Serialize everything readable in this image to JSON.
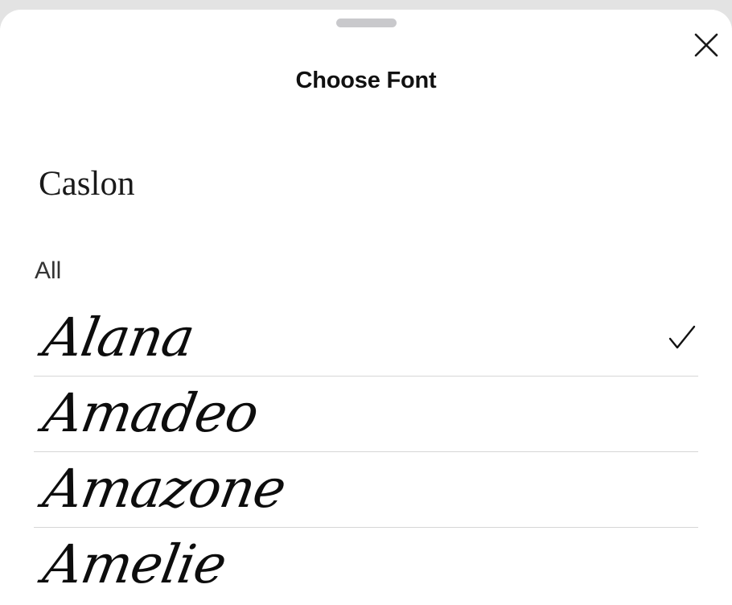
{
  "sheet": {
    "title": "Choose Font",
    "close_icon": "close-icon",
    "grabber_icon": "drag-handle"
  },
  "current": {
    "font_name": "Caslon"
  },
  "section": {
    "label": "All"
  },
  "fonts": [
    {
      "name": "Alana",
      "selected": true
    },
    {
      "name": "Amadeo",
      "selected": false
    },
    {
      "name": "Amazone",
      "selected": false
    },
    {
      "name": "Amelie",
      "selected": false
    }
  ],
  "colors": {
    "background": "#ffffff",
    "text": "#111111",
    "divider": "#d6d6d6",
    "grabber": "#c9c9cc"
  }
}
